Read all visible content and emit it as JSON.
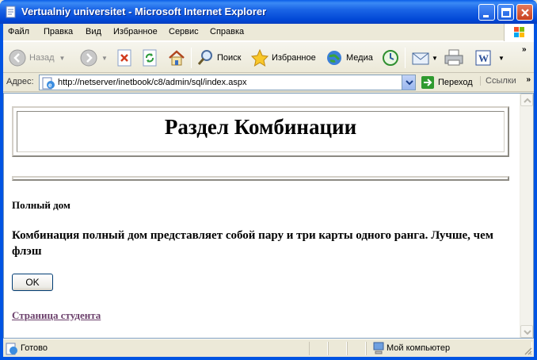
{
  "window": {
    "title": "Vertualniy universitet - Microsoft Internet Explorer"
  },
  "menu": {
    "items": [
      "Файл",
      "Правка",
      "Вид",
      "Избранное",
      "Сервис",
      "Справка"
    ]
  },
  "toolbar": {
    "back_label": "Назад",
    "search_label": "Поиск",
    "favorites_label": "Избранное",
    "media_label": "Медиа"
  },
  "address": {
    "label": "Адрес:",
    "url": "http://netserver/inetbook/c8/admin/sql/index.aspx",
    "go_label": "Переход",
    "links_label": "Ссылки"
  },
  "page": {
    "heading": "Раздел Комбинации",
    "subtitle": "Полный дом",
    "description": "Комбинация полный дом представляет собой пару и три карты одного ранга. Лучше, чем флэш",
    "ok_label": "OK",
    "student_link": "Страница студента"
  },
  "status": {
    "text": "Готово",
    "zone": "Мой компьютер"
  },
  "colors": {
    "title_bar": "#0054e3",
    "link_visited": "#6b3f6b"
  }
}
